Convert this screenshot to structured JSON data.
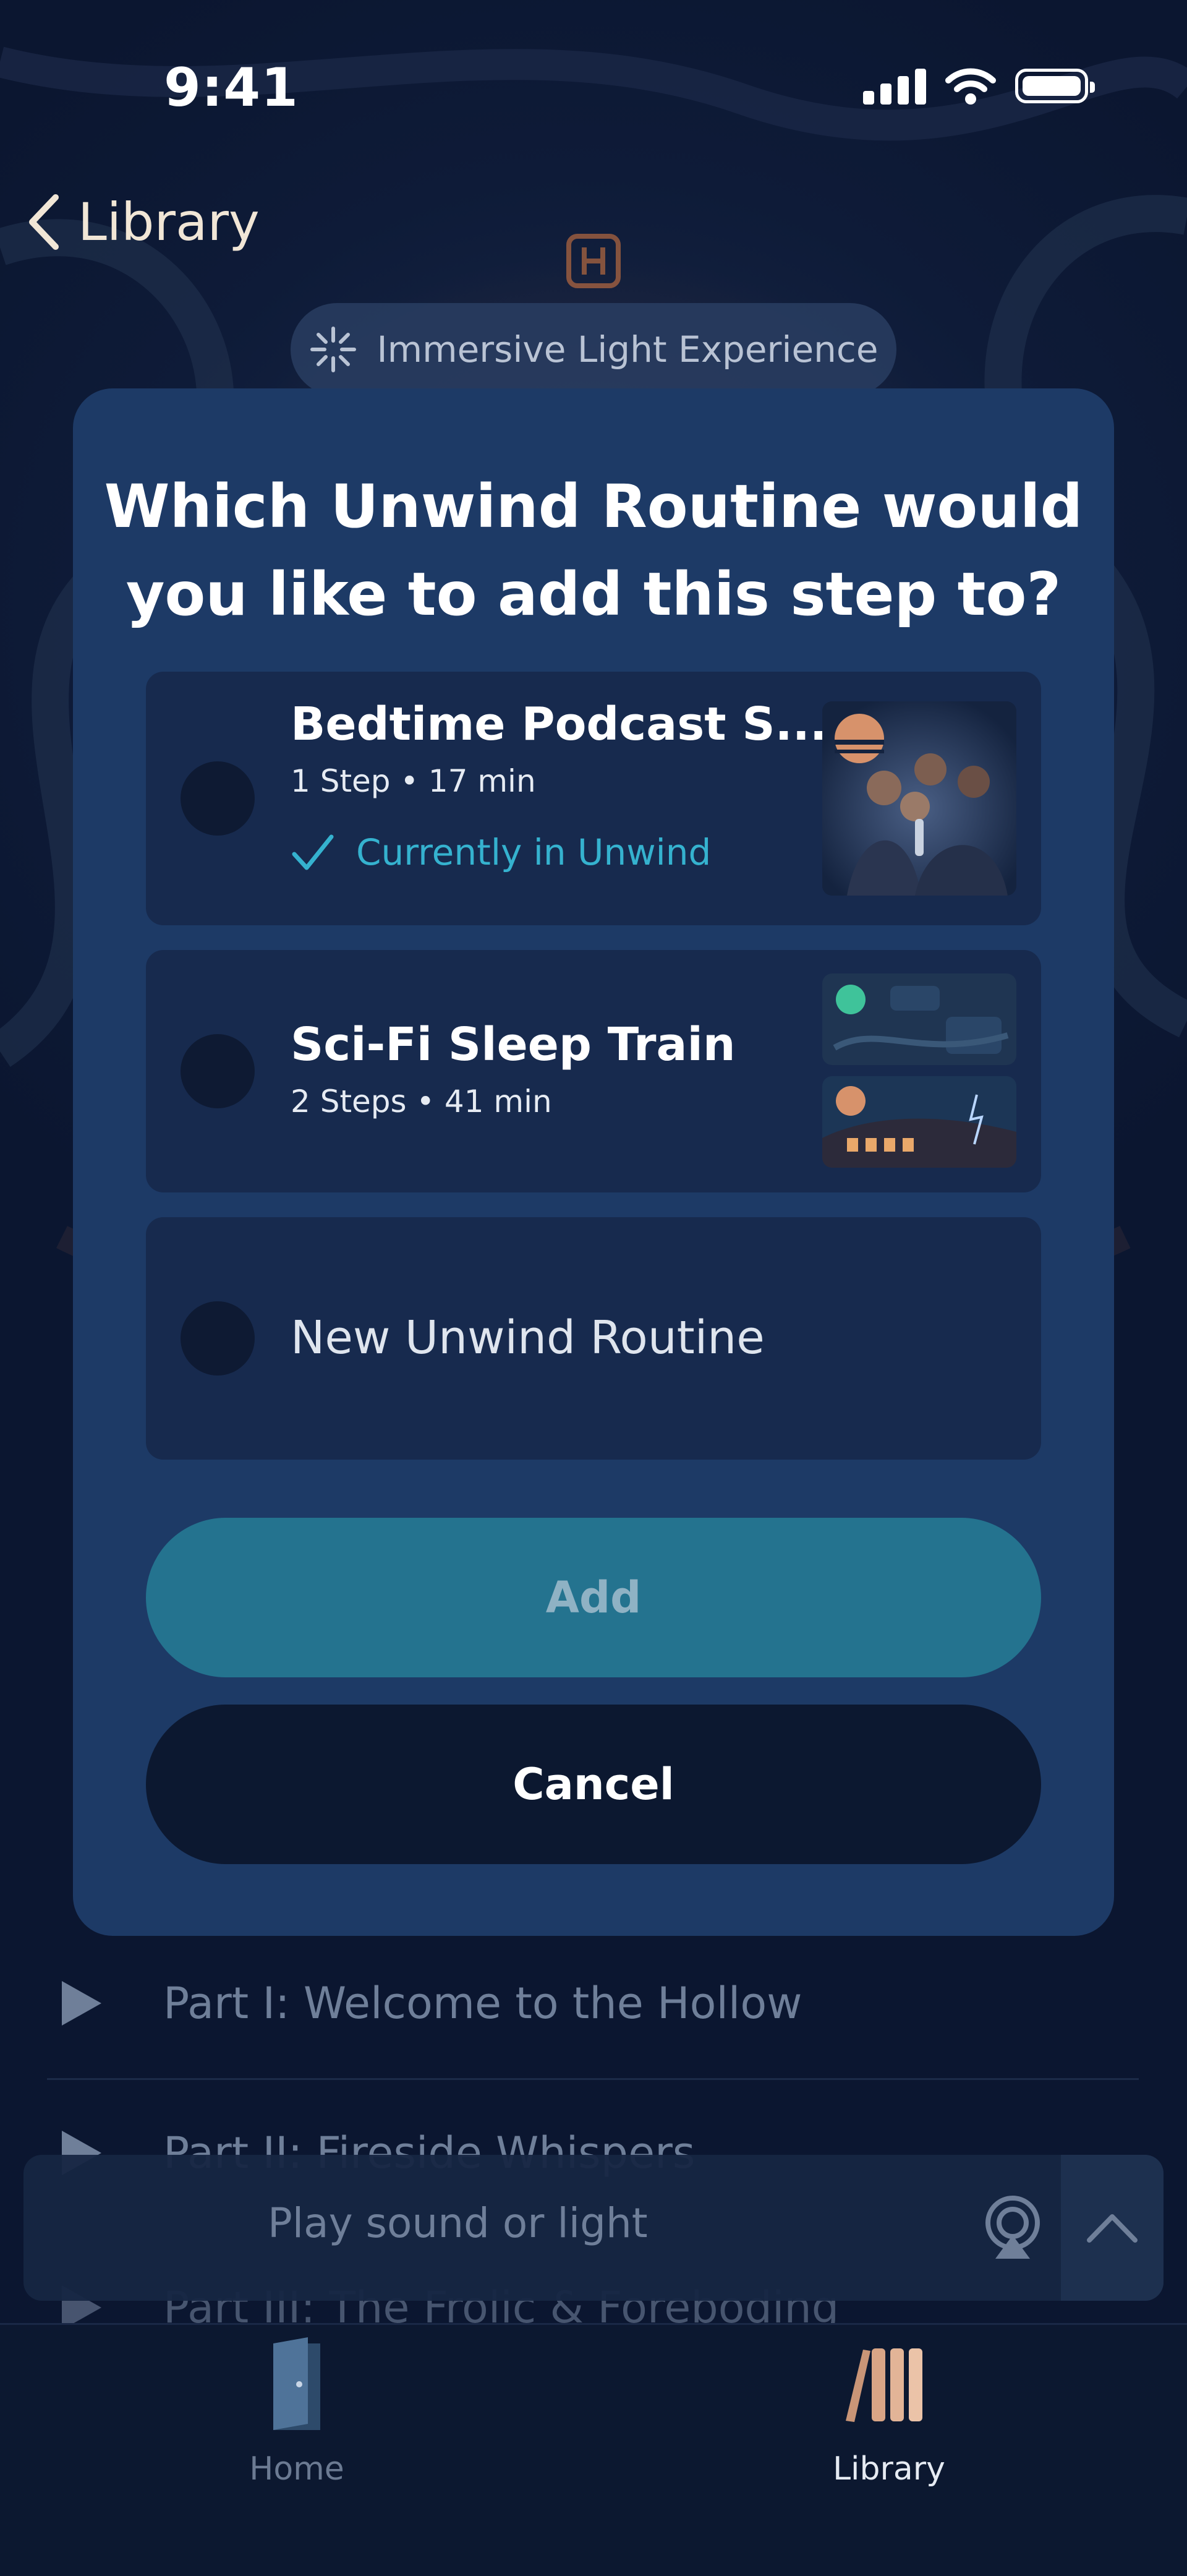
{
  "status_bar": {
    "time": "9:41"
  },
  "nav": {
    "back_label": "Library"
  },
  "background": {
    "badge": "Immersive Light Experience"
  },
  "sheet": {
    "title_line1": "Which Unwind Routine would",
    "title_line2": "you like to add this step to?",
    "options": [
      {
        "name": "Bedtime Podcast S...",
        "meta": "1 Step • 17 min",
        "status": "Currently in Unwind",
        "selected": false
      },
      {
        "name": "Sci-Fi Sleep Train",
        "meta": "2 Steps • 41 min",
        "selected": false
      },
      {
        "name": "New Unwind Routine",
        "selected": false
      }
    ],
    "add_label": "Add",
    "cancel_label": "Cancel"
  },
  "tracks": [
    "Part I: Welcome to the Hollow",
    "Part II: Fireside Whispers",
    "Part III: The Frolic & Foreboding"
  ],
  "mini_player": {
    "placeholder": "Play sound or light"
  },
  "tabbar": {
    "tabs": [
      {
        "label": "Home",
        "active": false
      },
      {
        "label": "Library",
        "active": true
      }
    ]
  },
  "colors": {
    "sheet_bg": "#1d3a66",
    "option_bg": "#172a4e",
    "accent": "#35b2cf",
    "add_button": "#24738f",
    "cancel_button": "#0c1830"
  }
}
